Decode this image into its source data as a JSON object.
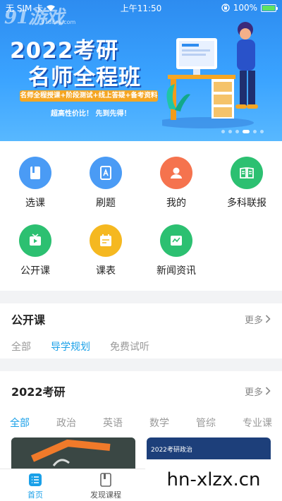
{
  "status_bar": {
    "carrier": "无 SIM 卡",
    "time": "上午11:50",
    "battery": "100%",
    "battery_level": 1.0
  },
  "banner": {
    "watermark": "91游戏",
    "watermark_sub": "91danji.com",
    "title_line1": "2022考研",
    "title_line2": "名师全程班",
    "tagline": "名师全程授课+阶段测试+线上答疑+备考资料",
    "slogan": "超高性价比！ 先到先得！",
    "slide_count": 6,
    "active_slide": 3
  },
  "grid": [
    {
      "label": "选课",
      "icon": "book-icon",
      "color": "#4a9bf5"
    },
    {
      "label": "刷题",
      "icon": "exercise-book-icon",
      "color": "#4a9bf5"
    },
    {
      "label": "我的",
      "icon": "user-icon",
      "color": "#f5734e"
    },
    {
      "label": "多科联报",
      "icon": "open-book-icon",
      "color": "#2cc071"
    },
    {
      "label": "公开课",
      "icon": "tv-play-icon",
      "color": "#2cc071"
    },
    {
      "label": "课表",
      "icon": "schedule-icon",
      "color": "#f5b820"
    },
    {
      "label": "新闻资讯",
      "icon": "news-icon",
      "color": "#2cc071"
    }
  ],
  "public_class": {
    "title": "公开课",
    "more": "更多",
    "tabs": [
      "全部",
      "导学规划",
      "免费试听"
    ],
    "active_tab": 1
  },
  "kaoyan": {
    "title": "2022考研",
    "more": "更多",
    "tabs": [
      "全部",
      "政治",
      "英语",
      "数学",
      "管综",
      "专业课"
    ],
    "active_tab": 0,
    "card2_caption": "2022考研政治"
  },
  "bottom_nav": [
    {
      "label": "首页",
      "icon": "home-list-icon",
      "active": true
    },
    {
      "label": "发现课程",
      "icon": "discover-icon",
      "active": false
    }
  ],
  "overlay_watermark": "hn-xlzx.cn"
}
